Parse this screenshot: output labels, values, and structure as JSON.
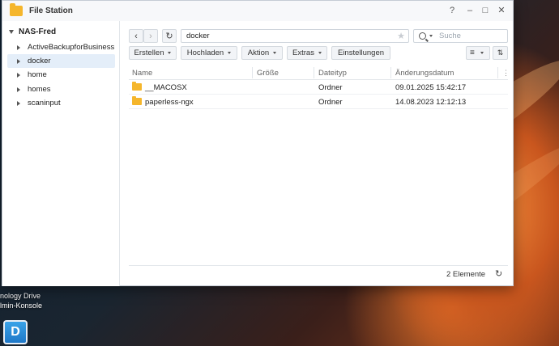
{
  "desktop": {
    "labels": [
      "nology Drive",
      "lmin-Konsole"
    ],
    "icon_name": "synology-drive-icon"
  },
  "window": {
    "title": "File Station",
    "controls": {
      "help": "?",
      "minimize": "–",
      "maximize": "□",
      "close": "✕"
    }
  },
  "sidebar": {
    "root": "NAS-Fred",
    "items": [
      {
        "label": "ActiveBackupforBusiness",
        "selected": false
      },
      {
        "label": "docker",
        "selected": true
      },
      {
        "label": "home",
        "selected": false
      },
      {
        "label": "homes",
        "selected": false
      },
      {
        "label": "scaninput",
        "selected": false
      }
    ]
  },
  "toolbar": {
    "path": "docker",
    "search_placeholder": "Suche",
    "buttons": [
      "Erstellen",
      "Hochladen",
      "Aktion",
      "Extras",
      "Einstellungen"
    ]
  },
  "table": {
    "columns": [
      "Name",
      "Größe",
      "Dateityp",
      "Änderungsdatum"
    ],
    "rows": [
      {
        "name": "__MACOSX",
        "size": "",
        "type": "Ordner",
        "modified": "09.01.2025 15:42:17"
      },
      {
        "name": "paperless-ngx",
        "size": "",
        "type": "Ordner",
        "modified": "14.08.2023 12:12:13"
      }
    ]
  },
  "status": {
    "count": "2 Elemente"
  },
  "colors": {
    "folder": "#f5b62c",
    "selection": "#e4eef9",
    "accent": "#1f78c8"
  }
}
